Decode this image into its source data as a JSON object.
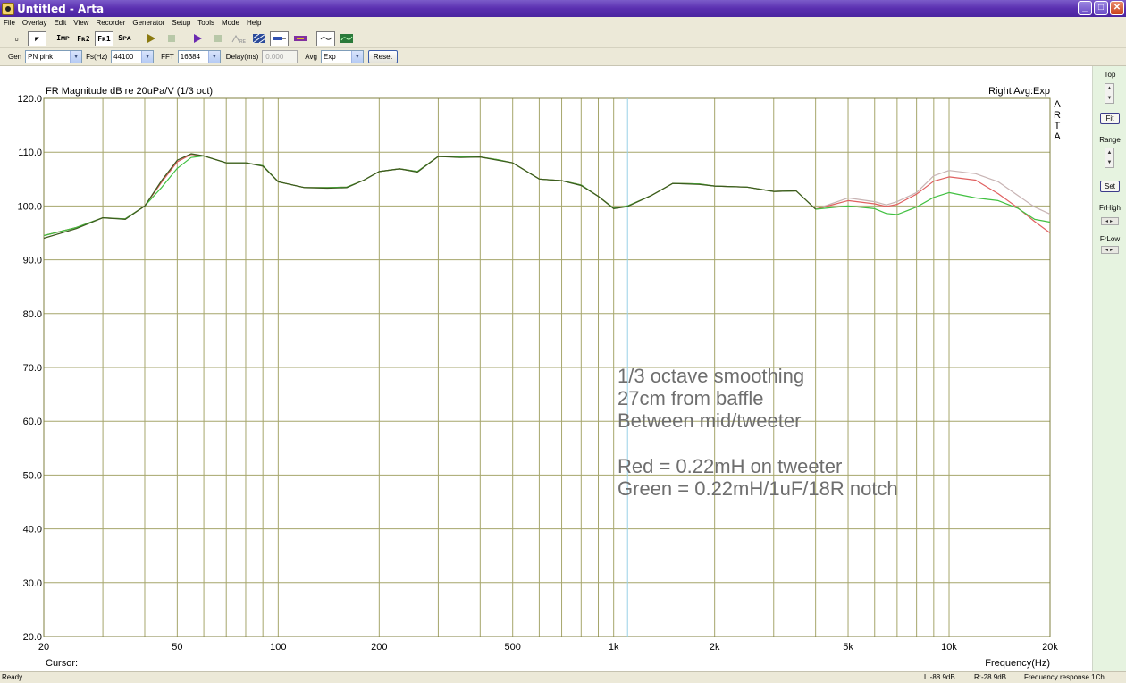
{
  "window": {
    "title": "Untitled - Arta",
    "minimize": "_",
    "maximize": "□",
    "close": "✕"
  },
  "menu": [
    "File",
    "Overlay",
    "Edit",
    "View",
    "Recorder",
    "Generator",
    "Setup",
    "Tools",
    "Mode",
    "Help"
  ],
  "toolbar": {
    "buttons": [
      {
        "name": "new-file",
        "label": "▫",
        "pressed": false
      },
      {
        "name": "pointer",
        "label": "◤",
        "pressed": true
      },
      {
        "name": "imp",
        "label": "Iᴍᴘ",
        "pressed": false
      },
      {
        "name": "fr2",
        "label": "Fʀ2",
        "pressed": false
      },
      {
        "name": "fr1",
        "label": "Fʀ1",
        "pressed": true
      },
      {
        "name": "spa",
        "label": "Sᴘᴀ",
        "pressed": false
      }
    ]
  },
  "genbar": {
    "gen_label": "Gen",
    "gen_value": "PN pink",
    "fs_label": "Fs(Hz)",
    "fs_value": "44100",
    "fft_label": "FFT",
    "fft_value": "16384",
    "delay_label": "Delay(ms)",
    "delay_value": "0.000",
    "avg_label": "Avg",
    "avg_value": "Exp",
    "reset_label": "Reset"
  },
  "side_panel": {
    "top_label": "Top",
    "fit_label": "Fit",
    "range_label": "Range",
    "set_label": "Set",
    "frhigh_label": "FrHigh",
    "frlow_label": "FrLow"
  },
  "statusbar": {
    "ready": "Ready",
    "left_level": "L:-88.9dB",
    "right_level": "R:-28.9dB",
    "mode": "Frequency response 1Ch"
  },
  "chart_data": {
    "type": "line",
    "title": "FR Magnitude dB re 20uPa/V (1/3 oct)",
    "top_right_label": "Right Avg:Exp",
    "brand": [
      "A",
      "R",
      "T",
      "A"
    ],
    "xlabel": "Frequency(Hz)",
    "ylabel": "",
    "cursor_label": "Cursor:",
    "x_scale": "log",
    "xlim": [
      20,
      20000
    ],
    "ylim": [
      20,
      120
    ],
    "grid": true,
    "y_ticks": [
      "20.0",
      "30.0",
      "40.0",
      "50.0",
      "60.0",
      "70.0",
      "80.0",
      "90.0",
      "100.0",
      "110.0",
      "120.0"
    ],
    "x_tick_values": [
      20,
      50,
      100,
      200,
      500,
      1000,
      2000,
      5000,
      10000,
      20000
    ],
    "x_tick_labels": [
      "20",
      "50",
      "100",
      "200",
      "500",
      "1k",
      "2k",
      "5k",
      "10k",
      "20k"
    ],
    "cursor_freq": 1100,
    "annotation": [
      "1/3 octave smoothing",
      "27cm from baffle",
      "Between mid/tweeter",
      "",
      "Red = 0.22mH on tweeter",
      "Green = 0.22mH/1uF/18R notch"
    ],
    "series": [
      {
        "color": "#c8b4b4",
        "x": [
          20,
          25,
          30,
          35,
          40,
          45,
          50,
          55,
          60,
          70,
          80,
          90,
          100,
          120,
          140,
          160,
          180,
          200,
          230,
          260,
          300,
          350,
          400,
          450,
          500,
          600,
          700,
          800,
          900,
          1000,
          1100,
          1300,
          1500,
          1800,
          2000,
          2500,
          3000,
          3500,
          4000,
          5000,
          6000,
          6500,
          7000,
          8000,
          9000,
          10000,
          12000,
          14000,
          16000,
          18000,
          20000
        ],
        "y": [
          94.5,
          96.0,
          97.8,
          97.6,
          100.0,
          104.5,
          108.2,
          109.6,
          109.3,
          108.0,
          108.0,
          107.5,
          104.5,
          103.4,
          103.4,
          103.5,
          104.8,
          106.4,
          106.9,
          106.4,
          109.2,
          109.1,
          109.1,
          108.6,
          108.0,
          105.0,
          104.7,
          103.9,
          101.8,
          99.6,
          100.0,
          102.0,
          104.2,
          104.1,
          103.7,
          103.5,
          102.7,
          102.8,
          99.4,
          101.5,
          100.8,
          100.2,
          100.8,
          102.5,
          105.6,
          106.6,
          106.0,
          104.5,
          102.0,
          99.8,
          98.5
        ]
      },
      {
        "color": "#e06060",
        "x": [
          20,
          25,
          30,
          35,
          40,
          45,
          50,
          55,
          60,
          70,
          80,
          90,
          100,
          120,
          140,
          160,
          180,
          200,
          230,
          260,
          300,
          350,
          400,
          450,
          500,
          600,
          700,
          800,
          900,
          1000,
          1100,
          1300,
          1500,
          1800,
          2000,
          2500,
          3000,
          3500,
          4000,
          5000,
          6000,
          6500,
          7000,
          8000,
          9000,
          10000,
          12000,
          14000,
          16000,
          18000,
          20000
        ],
        "y": [
          94.5,
          96.0,
          97.8,
          97.6,
          100.0,
          104.5,
          108.2,
          109.6,
          109.3,
          108.0,
          108.0,
          107.5,
          104.5,
          103.4,
          103.4,
          103.5,
          104.8,
          106.4,
          106.9,
          106.4,
          109.2,
          109.1,
          109.1,
          108.6,
          108.0,
          105.0,
          104.7,
          103.9,
          101.8,
          99.6,
          100.0,
          102.0,
          104.2,
          104.1,
          103.7,
          103.5,
          102.7,
          102.8,
          99.4,
          101.0,
          100.4,
          99.9,
          100.3,
          102.2,
          104.6,
          105.4,
          104.8,
          102.3,
          99.7,
          97.1,
          95.0
        ]
      },
      {
        "color": "#40c040",
        "x": [
          20,
          25,
          30,
          35,
          40,
          45,
          50,
          55,
          60,
          70,
          80,
          90,
          100,
          120,
          140,
          160,
          180,
          200,
          230,
          260,
          300,
          350,
          400,
          450,
          500,
          600,
          700,
          800,
          900,
          1000,
          1100,
          1300,
          1500,
          1800,
          2000,
          2500,
          3000,
          3500,
          4000,
          5000,
          6000,
          6500,
          7000,
          8000,
          9000,
          10000,
          12000,
          14000,
          16000,
          18000,
          20000
        ],
        "y": [
          94.5,
          96.0,
          97.8,
          97.6,
          100.0,
          103.5,
          107.0,
          109.0,
          109.3,
          108.0,
          108.0,
          107.5,
          104.5,
          103.4,
          103.4,
          103.5,
          104.8,
          106.4,
          106.9,
          106.4,
          109.2,
          109.1,
          109.1,
          108.6,
          108.0,
          105.0,
          104.7,
          103.9,
          101.8,
          99.6,
          100.0,
          102.0,
          104.2,
          104.1,
          103.7,
          103.5,
          102.7,
          102.8,
          99.4,
          100.0,
          99.5,
          98.6,
          98.4,
          99.8,
          101.6,
          102.5,
          101.5,
          101.0,
          99.6,
          97.5,
          97.0
        ]
      },
      {
        "color": "#3c5a1e",
        "x": [
          20,
          25,
          30,
          35,
          40,
          45,
          50,
          55,
          60,
          70,
          80,
          90,
          100,
          120,
          140,
          160,
          180,
          200,
          230,
          260,
          300,
          350,
          400,
          450,
          500,
          600,
          700,
          800,
          900,
          1000,
          1100,
          1300,
          1500,
          1800,
          2000,
          2500,
          3000,
          3500,
          4000
        ],
        "y": [
          94.0,
          95.8,
          97.8,
          97.5,
          100.0,
          104.8,
          108.5,
          109.7,
          109.3,
          108.0,
          108.0,
          107.4,
          104.5,
          103.4,
          103.3,
          103.4,
          104.8,
          106.4,
          106.9,
          106.3,
          109.2,
          109.0,
          109.1,
          108.5,
          108.0,
          105.0,
          104.7,
          103.8,
          101.8,
          99.5,
          99.9,
          102.0,
          104.2,
          104.0,
          103.7,
          103.5,
          102.7,
          102.8,
          99.4
        ]
      }
    ]
  }
}
